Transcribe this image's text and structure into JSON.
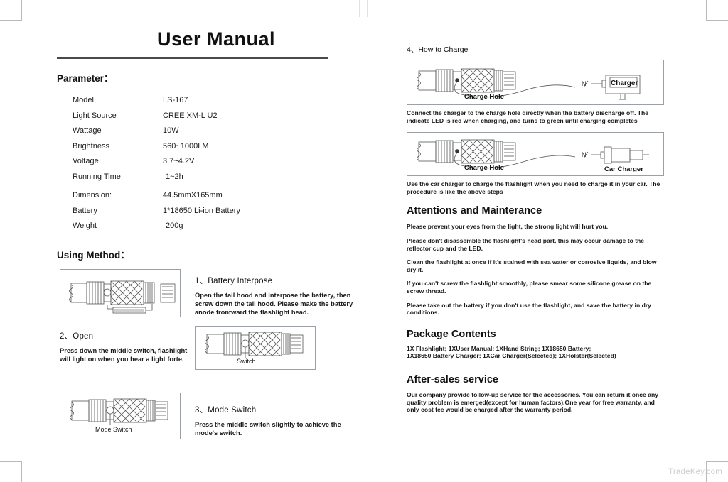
{
  "document": {
    "title": "User Manual",
    "watermark": "TradeKey.com"
  },
  "parameter_section": {
    "heading": "Parameter：",
    "rows": [
      {
        "key": "Model",
        "value": "LS-167"
      },
      {
        "key": "Light Source",
        "value": "CREE XM-L U2"
      },
      {
        "key": "Wattage",
        "value": "10W"
      },
      {
        "key": "Brightness",
        "value": "560~1000LM"
      },
      {
        "key": "Voltage",
        "value": "3.7~4.2V"
      },
      {
        "key": "Running Time",
        "value": "1~2h"
      },
      {
        "key": "Dimension:",
        "value": "44.5mmX165mm"
      },
      {
        "key": "Battery",
        "value": "1*18650 Li-ion Battery"
      },
      {
        "key": "Weight",
        "value": "200g"
      }
    ]
  },
  "using_method": {
    "heading": "Using Method：",
    "steps": [
      {
        "number": "1、Battery Interpose",
        "body": "Open the tail hood and interpose the battery, then screw down the tail hood. Please make the battery anode frontward the flashlight head.",
        "figure_caption": ""
      },
      {
        "number": "2、Open",
        "body": "Press down the middle switch, flashlight will light on when you hear a light forte.",
        "figure_caption": "Switch"
      },
      {
        "number": "3、Mode Switch",
        "body": "Press the middle switch slightly to achieve the mode's switch.",
        "figure_caption": "Mode Switch"
      }
    ]
  },
  "charging": {
    "step_number": "4、How to Charge",
    "wall_figure": {
      "charge_hole_label": "Charge Hole",
      "plug_label": "N",
      "device_label": "Charger"
    },
    "wall_note": "Connect the charger to the charge hole directly when the battery discharge off. The indicate LED is red when charging, and turns to green until charging completes",
    "car_figure": {
      "charge_hole_label": "Charge Hole",
      "plug_label": "N",
      "device_label": "Car Charger"
    },
    "car_note": "Use the car charger to charge the flashlight when you need to charge  it in your car. The procedure is like the above steps"
  },
  "attentions": {
    "heading": "Attentions and Mainterance",
    "items": [
      "Please prevent your eyes from the light, the strong light will hurt you.",
      "Please don't disassemble the flashlight's head part, this may occur damage to the reflector cup and the LED.",
      "Clean the flashlight at once if it's stained with sea water or corrosive liquids, and blow dry it.",
      "If you can't screw the flashlight smoothly, please smear some silicone grease on the screw thread.",
      "Please take out the battery if you don't use the flashlight, and save the battery in dry conditions."
    ]
  },
  "package_contents": {
    "heading": "Package Contents",
    "line1": "1X Flashlight;    1XUser Manual;  1XHand String;  1X18650 Battery;",
    "line2": "1X18650 Battery  Charger;  1XCar Charger(Selected); 1XHolster(Selected)"
  },
  "after_sales": {
    "heading": "After-sales service",
    "body": "Our company provide follow-up service for the accessories. You can return it once any quality problem is emerged(except for human factors).One year for free warranty, and only cost fee would be charged after the warranty period."
  }
}
